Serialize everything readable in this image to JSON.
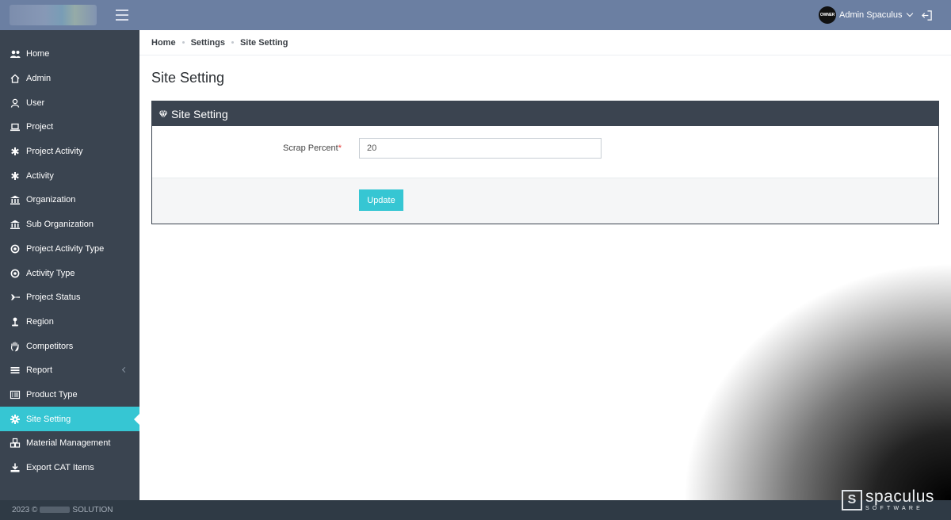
{
  "header": {
    "user_name": "Admin Spaculus",
    "avatar_text": "OWNER"
  },
  "sidebar": {
    "items": [
      {
        "label": "Home",
        "icon": "users-icon"
      },
      {
        "label": "Admin",
        "icon": "home-icon"
      },
      {
        "label": "User",
        "icon": "user-icon"
      },
      {
        "label": "Project",
        "icon": "laptop-icon"
      },
      {
        "label": "Project Activity",
        "icon": "asterisk-icon"
      },
      {
        "label": "Activity",
        "icon": "asterisk-icon"
      },
      {
        "label": "Organization",
        "icon": "bank-icon"
      },
      {
        "label": "Sub Organization",
        "icon": "bank-icon"
      },
      {
        "label": "Project Activity Type",
        "icon": "target-icon"
      },
      {
        "label": "Activity Type",
        "icon": "target-icon"
      },
      {
        "label": "Project Status",
        "icon": "plane-icon"
      },
      {
        "label": "Region",
        "icon": "pin-icon"
      },
      {
        "label": "Competitors",
        "icon": "hand-icon"
      },
      {
        "label": "Report",
        "icon": "list-icon"
      },
      {
        "label": "Product Type",
        "icon": "list-alt-icon"
      },
      {
        "label": "Site Setting",
        "icon": "gear-icon"
      },
      {
        "label": "Material Management",
        "icon": "cubes-icon"
      },
      {
        "label": "Export CAT Items",
        "icon": "download-icon"
      }
    ],
    "active_index": 15
  },
  "breadcrumb": [
    "Home",
    "Settings",
    "Site Setting"
  ],
  "page": {
    "title": "Site Setting"
  },
  "panel": {
    "title": "Site Setting",
    "field_label": "Scrap Percent",
    "required_mark": "*",
    "field_value": "20",
    "submit_label": "Update"
  },
  "footer": {
    "prefix": "2023 ©",
    "suffix": "SOLUTION"
  },
  "watermark": {
    "brand": "spaculus",
    "sub": "SOFTWARE"
  }
}
